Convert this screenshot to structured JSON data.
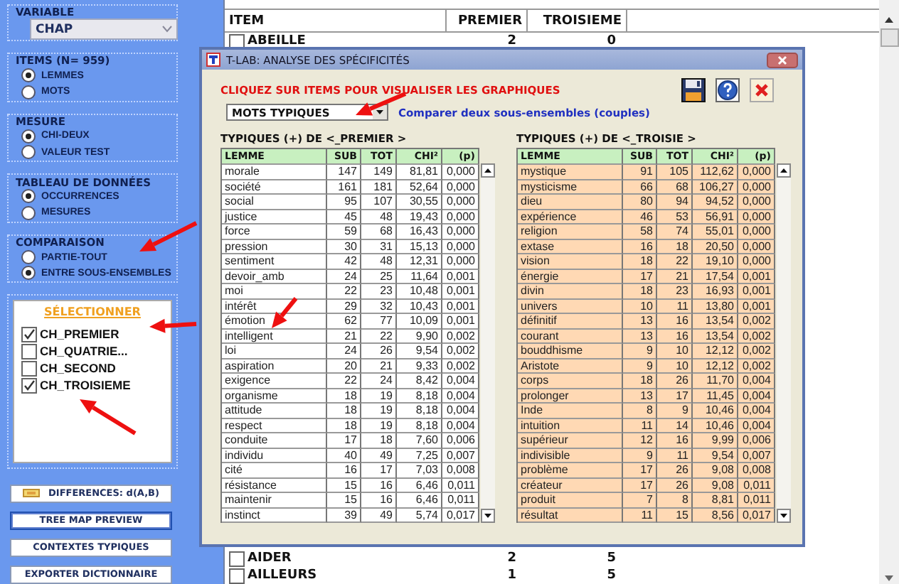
{
  "sidebar": {
    "variable": {
      "label": "VARIABLE",
      "value": "CHAP"
    },
    "radio_groups": [
      {
        "title": "ITEMS (N= 959)",
        "options": [
          {
            "label": "LEMMES",
            "selected": true
          },
          {
            "label": "MOTS",
            "selected": false
          }
        ]
      },
      {
        "title": "MESURE",
        "options": [
          {
            "label": "CHI-DEUX",
            "selected": true
          },
          {
            "label": "VALEUR TEST",
            "selected": false
          }
        ]
      },
      {
        "title": "TABLEAU DE DONNÉES",
        "options": [
          {
            "label": "OCCURRENCES",
            "selected": true
          },
          {
            "label": "MESURES",
            "selected": false
          }
        ]
      },
      {
        "title": "COMPARAISON",
        "options": [
          {
            "label": "PARTIE-TOUT",
            "selected": false
          },
          {
            "label": "ENTRE SOUS-ENSEMBLES",
            "selected": true
          }
        ]
      }
    ],
    "select_list": {
      "title": "SÉLECTIONNER",
      "items": [
        {
          "label": "CH_PREMIER",
          "checked": true
        },
        {
          "label": "CH_QUATRIE...",
          "checked": false
        },
        {
          "label": "CH_SECOND",
          "checked": false
        },
        {
          "label": "CH_TROISIEME",
          "checked": true
        }
      ]
    },
    "buttons": [
      {
        "label": "DIFFERENCES: d(A,B)",
        "kind": "icon"
      },
      {
        "label": "TREE MAP PREVIEW",
        "kind": "focused"
      },
      {
        "label": "CONTEXTES TYPIQUES",
        "kind": "plain"
      },
      {
        "label": "EXPORTER DICTIONNAIRE",
        "kind": "plain"
      }
    ]
  },
  "background_table": {
    "columns": [
      "ITEM",
      "PREMIER",
      "TROISIEME"
    ],
    "top_rows": [
      {
        "item": "ABEILLE",
        "checked": false,
        "values": [
          "2",
          "0"
        ]
      }
    ],
    "bottom_rows": [
      {
        "item": "AIDER",
        "checked": false,
        "values": [
          "2",
          "5"
        ]
      },
      {
        "item": "AILLEURS",
        "checked": false,
        "values": [
          "1",
          "5"
        ]
      }
    ]
  },
  "dialog": {
    "title": "T-LAB: ANALYSE DES SPÉCIFICITÉS",
    "instruction": "CLIQUEZ SUR ITEMS POUR VISUALISER LES GRAPHIQUES",
    "dropdown": {
      "value": "MOTS TYPIQUES"
    },
    "description": "Comparer deux sous-ensembles (couples)",
    "tables": [
      {
        "title": "TYPIQUES (+) DE <_PREMIER >",
        "kind": "plain",
        "columns": [
          "LEMME",
          "SUB",
          "TOT",
          "CHI²",
          "(p)"
        ],
        "rows": [
          [
            "morale",
            "147",
            "149",
            "81,81",
            "0,000"
          ],
          [
            "société",
            "161",
            "181",
            "52,64",
            "0,000"
          ],
          [
            "social",
            "95",
            "107",
            "30,55",
            "0,000"
          ],
          [
            "justice",
            "45",
            "48",
            "19,43",
            "0,000"
          ],
          [
            "force",
            "59",
            "68",
            "16,43",
            "0,000"
          ],
          [
            "pression",
            "30",
            "31",
            "15,13",
            "0,000"
          ],
          [
            "sentiment",
            "42",
            "48",
            "12,31",
            "0,000"
          ],
          [
            "devoir_amb",
            "24",
            "25",
            "11,64",
            "0,001"
          ],
          [
            "moi",
            "22",
            "23",
            "10,48",
            "0,001"
          ],
          [
            "intérêt",
            "29",
            "32",
            "10,43",
            "0,001"
          ],
          [
            "émotion",
            "62",
            "77",
            "10,09",
            "0,001"
          ],
          [
            "intelligent",
            "21",
            "22",
            "9,90",
            "0,002"
          ],
          [
            "loi",
            "24",
            "26",
            "9,54",
            "0,002"
          ],
          [
            "aspiration",
            "20",
            "21",
            "9,33",
            "0,002"
          ],
          [
            "exigence",
            "22",
            "24",
            "8,42",
            "0,004"
          ],
          [
            "organisme",
            "18",
            "19",
            "8,18",
            "0,004"
          ],
          [
            "attitude",
            "18",
            "19",
            "8,18",
            "0,004"
          ],
          [
            "respect",
            "18",
            "19",
            "8,18",
            "0,004"
          ],
          [
            "conduite",
            "17",
            "18",
            "7,60",
            "0,006"
          ],
          [
            "individu",
            "40",
            "49",
            "7,25",
            "0,007"
          ],
          [
            "cité",
            "16",
            "17",
            "7,03",
            "0,008"
          ],
          [
            "résistance",
            "15",
            "16",
            "6,46",
            "0,011"
          ],
          [
            "maintenir",
            "15",
            "16",
            "6,46",
            "0,011"
          ],
          [
            "instinct",
            "39",
            "49",
            "5,74",
            "0,017"
          ]
        ]
      },
      {
        "title": "TYPIQUES (+) DE <_TROISIE >",
        "kind": "highlighted",
        "columns": [
          "LEMME",
          "SUB",
          "TOT",
          "CHI²",
          "(p)"
        ],
        "rows": [
          [
            "mystique",
            "91",
            "105",
            "112,62",
            "0,000"
          ],
          [
            "mysticisme",
            "66",
            "68",
            "106,27",
            "0,000"
          ],
          [
            "dieu",
            "80",
            "94",
            "94,52",
            "0,000"
          ],
          [
            "expérience",
            "46",
            "53",
            "56,91",
            "0,000"
          ],
          [
            "religion",
            "58",
            "74",
            "55,01",
            "0,000"
          ],
          [
            "extase",
            "16",
            "18",
            "20,50",
            "0,000"
          ],
          [
            "vision",
            "18",
            "22",
            "19,10",
            "0,000"
          ],
          [
            "énergie",
            "17",
            "21",
            "17,54",
            "0,001"
          ],
          [
            "divin",
            "18",
            "23",
            "16,93",
            "0,001"
          ],
          [
            "univers",
            "10",
            "11",
            "13,80",
            "0,001"
          ],
          [
            "définitif",
            "13",
            "16",
            "13,54",
            "0,002"
          ],
          [
            "courant",
            "13",
            "16",
            "13,54",
            "0,002"
          ],
          [
            "bouddhisme",
            "9",
            "10",
            "12,12",
            "0,002"
          ],
          [
            "Aristote",
            "9",
            "10",
            "12,12",
            "0,002"
          ],
          [
            "corps",
            "18",
            "26",
            "11,70",
            "0,004"
          ],
          [
            "prolonger",
            "13",
            "17",
            "11,45",
            "0,004"
          ],
          [
            "Inde",
            "8",
            "9",
            "10,46",
            "0,004"
          ],
          [
            "intuition",
            "11",
            "14",
            "10,46",
            "0,004"
          ],
          [
            "supérieur",
            "12",
            "16",
            "9,99",
            "0,006"
          ],
          [
            "indivisible",
            "9",
            "11",
            "9,54",
            "0,007"
          ],
          [
            "problème",
            "17",
            "26",
            "9,08",
            "0,008"
          ],
          [
            "créateur",
            "17",
            "26",
            "9,08",
            "0,011"
          ],
          [
            "produit",
            "7",
            "8",
            "8,81",
            "0,011"
          ],
          [
            "résultat",
            "11",
            "15",
            "8,56",
            "0,017"
          ]
        ]
      }
    ]
  },
  "annotations": [
    {
      "kind": "arrow"
    },
    {
      "kind": "arrow"
    },
    {
      "kind": "arrow"
    },
    {
      "kind": "arrow"
    },
    {
      "kind": "arrow"
    }
  ]
}
